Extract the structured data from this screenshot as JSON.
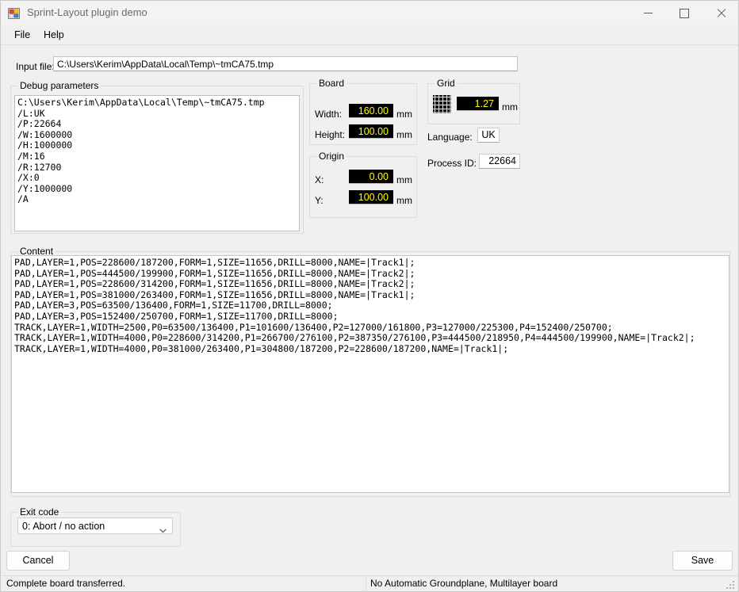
{
  "window": {
    "title": "Sprint-Layout plugin demo",
    "icon": "app-squares-icon",
    "minimize_label": "Minimize",
    "maximize_label": "Maximize",
    "close_label": "Close"
  },
  "menu": {
    "items": [
      {
        "label": "File"
      },
      {
        "label": "Help"
      }
    ]
  },
  "input_file": {
    "label": "Input file:",
    "value": "C:\\Users\\Kerim\\AppData\\Local\\Temp\\~tmCA75.tmp",
    "placeholder": ""
  },
  "debug": {
    "title": "Debug parameters",
    "text": "C:\\Users\\Kerim\\AppData\\Local\\Temp\\~tmCA75.tmp\n/L:UK\n/P:22664\n/W:1600000\n/H:1000000\n/M:16\n/R:12700\n/X:0\n/Y:1000000\n/A"
  },
  "board": {
    "title": "Board",
    "width_label": "Width:",
    "width_value": "160.00",
    "width_unit": "mm",
    "height_label": "Height:",
    "height_value": "100.00",
    "height_unit": "mm"
  },
  "origin": {
    "title": "Origin",
    "x_label": "X:",
    "x_value": "0.00",
    "x_unit": "mm",
    "y_label": "Y:",
    "y_value": "100.00",
    "y_unit": "mm"
  },
  "grid": {
    "title": "Grid",
    "icon": "grid-icon",
    "value": "1.27",
    "unit": "mm"
  },
  "language": {
    "label": "Language:",
    "value": "UK"
  },
  "process": {
    "label": "Process ID:",
    "value": "22664"
  },
  "content": {
    "title": "Content",
    "text": "PAD,LAYER=1,POS=228600/187200,FORM=1,SIZE=11656,DRILL=8000,NAME=|Track1|;\nPAD,LAYER=1,POS=444500/199900,FORM=1,SIZE=11656,DRILL=8000,NAME=|Track2|;\nPAD,LAYER=1,POS=228600/314200,FORM=1,SIZE=11656,DRILL=8000,NAME=|Track2|;\nPAD,LAYER=1,POS=381000/263400,FORM=1,SIZE=11656,DRILL=8000,NAME=|Track1|;\nPAD,LAYER=3,POS=63500/136400,FORM=1,SIZE=11700,DRILL=8000;\nPAD,LAYER=3,POS=152400/250700,FORM=1,SIZE=11700,DRILL=8000;\nTRACK,LAYER=1,WIDTH=2500,P0=63500/136400,P1=101600/136400,P2=127000/161800,P3=127000/225300,P4=152400/250700;\nTRACK,LAYER=1,WIDTH=4000,P0=228600/314200,P1=266700/276100,P2=387350/276100,P3=444500/218950,P4=444500/199900,NAME=|Track2|;\nTRACK,LAYER=1,WIDTH=4000,P0=381000/263400,P1=304800/187200,P2=228600/187200,NAME=|Track1|;"
  },
  "exit_code": {
    "title": "Exit code",
    "selected": "0: Abort / no action",
    "options": [
      "0: Abort / no action"
    ],
    "arrow_icon": "chevron-down-icon"
  },
  "buttons": {
    "cancel": "Cancel",
    "save": "Save"
  },
  "status": {
    "left": "Complete board transferred.",
    "right": "No Automatic Groundplane, Multilayer board",
    "grip": "resize-grip-icon"
  },
  "colors": {
    "window_bg": "#f0f0f0",
    "field_bg": "#000000",
    "field_text": "#ffff00",
    "title_text": "#6b6b6b"
  }
}
